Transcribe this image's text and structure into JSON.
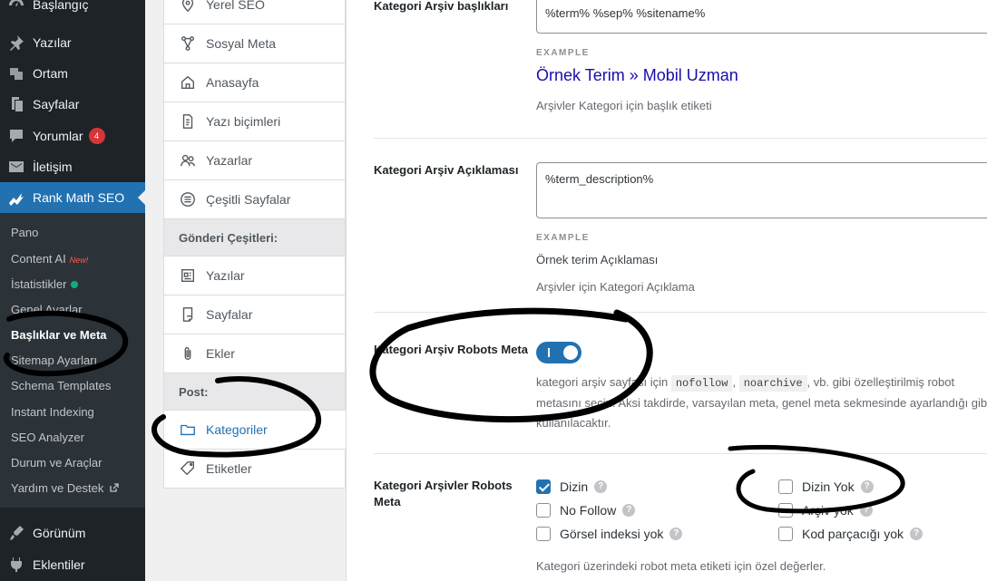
{
  "wp_menu": [
    {
      "label": "Başlangıç",
      "icon": "dashboard-icon"
    },
    {
      "label": "Yazılar",
      "icon": "pin-icon"
    },
    {
      "label": "Ortam",
      "icon": "media-icon"
    },
    {
      "label": "Sayfalar",
      "icon": "pages-icon"
    },
    {
      "label": "Yorumlar",
      "icon": "comments-icon",
      "badge": "4"
    },
    {
      "label": "İletişim",
      "icon": "mail-icon"
    },
    {
      "label": "Rank Math SEO",
      "icon": "rank-math-icon"
    },
    {
      "label": "Görünüm",
      "icon": "brush-icon"
    },
    {
      "label": "Eklentiler",
      "icon": "plugin-icon"
    }
  ],
  "rank_math_submenu": [
    {
      "label": "Pano"
    },
    {
      "label": "Content AI",
      "tag": "New!"
    },
    {
      "label": "İstatistikler",
      "status": "green-dot"
    },
    {
      "label": "Genel Ayarlar"
    },
    {
      "label": "Başlıklar ve Meta",
      "current": true
    },
    {
      "label": "Sitemap Ayarları"
    },
    {
      "label": "Schema Templates"
    },
    {
      "label": "Instant Indexing"
    },
    {
      "label": "SEO Analyzer"
    },
    {
      "label": "Durum ve Araçlar"
    },
    {
      "label": "Yardım ve Destek",
      "external_icon": true
    }
  ],
  "settings_nav": {
    "items": [
      {
        "label": "Yerel SEO",
        "icon": "location-icon"
      },
      {
        "label": "Sosyal Meta",
        "icon": "social-icon"
      },
      {
        "label": "Anasayfa",
        "icon": "home-icon"
      },
      {
        "label": "Yazı biçimleri",
        "icon": "post-format-icon"
      },
      {
        "label": "Yazarlar",
        "icon": "authors-icon"
      },
      {
        "label": "Çeşitli Sayfalar",
        "icon": "misc-pages-icon"
      }
    ],
    "section_post_types": "Gönderi Çeşitleri:",
    "post_types": [
      {
        "label": "Yazılar",
        "icon": "post-icon"
      },
      {
        "label": "Sayfalar",
        "icon": "page-icon"
      },
      {
        "label": "Ekler",
        "icon": "attachment-icon"
      }
    ],
    "section_post": "Post:",
    "taxonomies": [
      {
        "label": "Kategoriler",
        "icon": "folder-icon",
        "active": true
      },
      {
        "label": "Etiketler",
        "icon": "tag-icon"
      }
    ]
  },
  "fields": {
    "archive_title": {
      "label": "Kategori Arşiv başlıkları",
      "value": "%term% %sep% %sitename%",
      "example_label": "EXAMPLE",
      "example_value": "Örnek Terim » Mobil Uzman",
      "help": "Arşivler Kategori için başlık etiketi"
    },
    "archive_description": {
      "label": "Kategori Arşiv Açıklaması",
      "value": "%term_description%",
      "example_label": "EXAMPLE",
      "example_value": "Örnek terim Açıklaması",
      "help": "Arşivler için Kategori Açıklama"
    },
    "robots_meta_toggle": {
      "label": "Kategori Arşiv Robots Meta",
      "enabled": true,
      "help_prefix": "kategori arşiv sayfası için",
      "code1": "nofollow",
      "code2": "noarchive",
      "help_suffix": ", vb. gibi özelleştirilmiş robot",
      "help_line2": "metasını seçin. Aksi takdirde, varsayılan meta, genel meta sekmesinde ayarlandığı gibi",
      "help_line3": "kullanılacaktır."
    },
    "robots_meta": {
      "label": "Kategori Arşivler Robots Meta",
      "options": [
        {
          "label": "Dizin",
          "checked": true
        },
        {
          "label": "No Follow",
          "checked": false
        },
        {
          "label": "Görsel indeksi yok",
          "checked": false
        },
        {
          "label": "Dizin Yok",
          "checked": false
        },
        {
          "label": "Arşiv yok",
          "checked": false
        },
        {
          "label": "Kod parçacığı yok",
          "checked": false
        }
      ],
      "help": "Kategori üzerindeki robot meta etiketi için özel değerler."
    }
  },
  "help_glyph": "?",
  "colors": {
    "wp_sidebar": "#1d2327",
    "accent": "#2271b1",
    "example_link": "#1a0dab"
  }
}
